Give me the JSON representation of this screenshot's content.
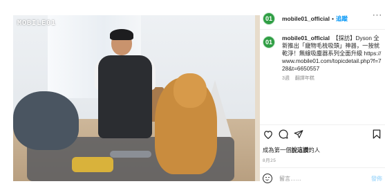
{
  "media": {
    "watermark": "MOBILE01"
  },
  "post": {
    "username": "mobile01_official",
    "dot": "•",
    "follow_label": "追蹤",
    "more_label": "···",
    "avatar_text": "01",
    "caption": "【採訪】Dyson 全新推出「寵物毛梳吸頭」神器，一按就乾淨！無線吸塵器系列全面升級 https://www.mobile01.com/topicdetail.php?f=728&t=6650557",
    "caption_age": "3週",
    "see_translation": "翻譯年糕",
    "likes_prefix": "成為第一個",
    "likes_bold": "說這讚",
    "likes_suffix": "的人",
    "date": "8月25",
    "comment_placeholder": "留言……",
    "post_label": "發佈"
  },
  "icons": {
    "like": "heart-icon",
    "comment": "comment-icon",
    "share": "send-icon",
    "save": "bookmark-icon",
    "emoji": "emoji-icon",
    "more": "more-icon"
  },
  "colors": {
    "accent": "#0095f6",
    "post_button_disabled": "#b2dffc",
    "muted_text": "#8e8e8e",
    "avatar": "#2f9e44"
  }
}
